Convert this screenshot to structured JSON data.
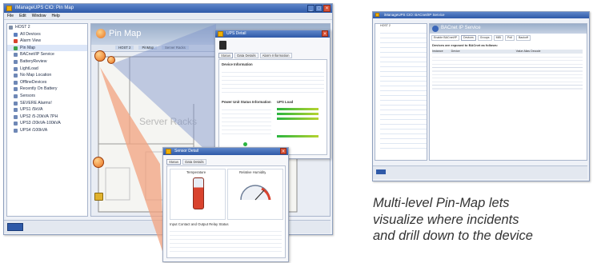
{
  "left_window": {
    "title": "iManageUPS CIO: Pin Map",
    "menu": [
      "File",
      "Edit",
      "Window",
      "Help"
    ],
    "tree_root": "HOST 2",
    "tree_items": [
      "All Devices",
      "Alarm View",
      "Pin Map",
      "BACnet/IP Service",
      "BatteryReview",
      "LightLoad",
      "No Map Location",
      "OfflineDevices",
      "Recently On Battery",
      "Sensors",
      "SEVERE Alarms!",
      "UPS1 /5kVA",
      "UPS2 /5-20kVA 7PH",
      "UPS3 /20kVA-100kVA",
      "UPS4 /100kVA"
    ],
    "selected_index": 2,
    "map_title": "Pin Map",
    "map_label": "Server Racks",
    "breadcrumb": [
      "HOST 2",
      "PinMap",
      "Server Racks"
    ]
  },
  "device_dialog": {
    "title": "UPS Detail",
    "tabs": [
      "Status",
      "Data Details",
      "Alarm Information"
    ],
    "sections": [
      "Device Information",
      "Power Unit Status Information",
      "UPS Load"
    ]
  },
  "sensor_dialog": {
    "title": "Sensor Detail",
    "tabs": [
      "Status",
      "Data Details"
    ],
    "panels": [
      "Temperature",
      "Relative Humidity"
    ],
    "footer_section": "Input Contact and Output Relay Status"
  },
  "bacnet_window": {
    "title": "iManageUPS CIO: BACnet/IP Service",
    "panel_title": "BACnet IP Service",
    "tabs": [
      "Enable BACnet/IP",
      "Devices",
      "Groups",
      "MIB",
      "Poll",
      "Backoff"
    ],
    "subheader": "Devices are exposed to BACnet as follows:",
    "columns": [
      "Instance",
      "Device",
      "Value Alias Decode"
    ]
  },
  "caption": {
    "lines": [
      "Multi-level Pin-Map lets",
      "visualize where incidents",
      "and drill down to the device"
    ]
  },
  "colors": {
    "pin": "#e8711f",
    "beam": "#f2a17f",
    "accent": "#3a66b8"
  }
}
